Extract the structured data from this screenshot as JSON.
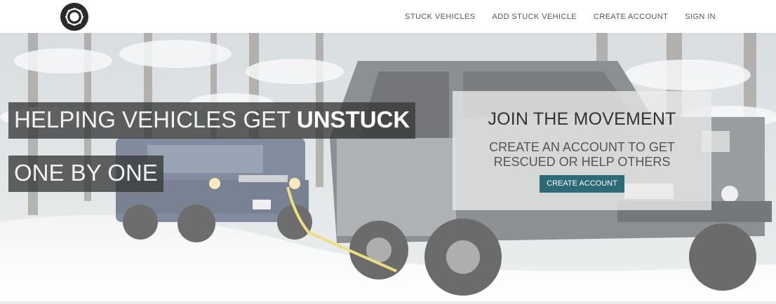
{
  "nav": {
    "logo_icon": "wheel-logo-icon",
    "links": [
      {
        "label": "STUCK VEHICLES"
      },
      {
        "label": "ADD STUCK VEHICLE"
      },
      {
        "label": "CREATE ACCOUNT"
      },
      {
        "label": "SIGN IN"
      }
    ]
  },
  "hero": {
    "headline_1_prefix": "HELPING VEHICLES GET ",
    "headline_1_strong": "UNSTUCK",
    "headline_2": "ONE BY ONE",
    "background_description_icon": "snowy-forest-suv-photo",
    "card": {
      "title": "JOIN THE MOVEMENT",
      "subtitle": "CREATE AN ACCOUNT TO GET RESCUED OR HELP OTHERS",
      "button_label": "CREATE ACCOUNT"
    }
  },
  "colors": {
    "button_bg": "#2d6a78",
    "headline_bg": "#3a3a3a",
    "nav_text": "#555555"
  }
}
